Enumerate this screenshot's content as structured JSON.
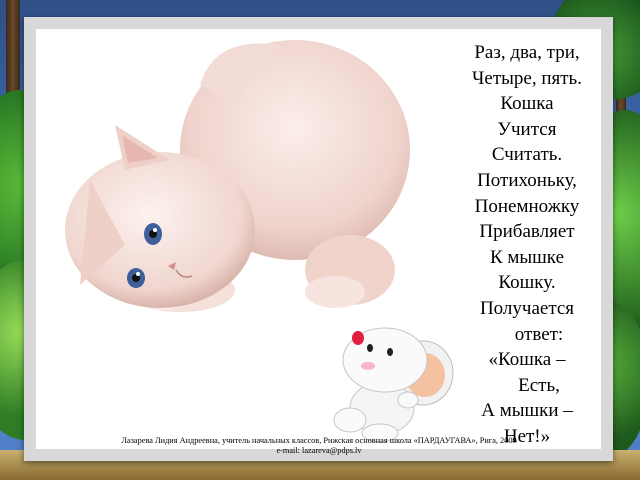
{
  "poem": {
    "lines": [
      "Раз, два, три,",
      "Четыре, пять.",
      "Кошка",
      "Учится",
      "Считать.",
      "Потихоньку,",
      "Понемножку",
      "Прибавляет",
      "К мышке",
      "Кошку.",
      "Получается",
      "ответ:",
      "«Кошка –",
      "Есть,",
      "А мышки –",
      "Нет!»"
    ]
  },
  "footer": {
    "author_line": "Лазарева Лидия Андреевна, учитель начальных классов, Рижская основная школа «ПАРДАУГАВА», Рига, 2009",
    "email_line": "e-mail: lazareva@pdps.lv"
  },
  "images": {
    "kitten": "kitten-illustration",
    "mouse": "mouse-illustration"
  },
  "colors": {
    "slide_background": "#ffffff",
    "slide_frame": "#d8d8d8",
    "kitten_fur": "#f3dcd6",
    "kitten_eye": "#3f5f9a",
    "mouse_fur": "#f2f2f2",
    "mouse_nose": "#e02040"
  }
}
